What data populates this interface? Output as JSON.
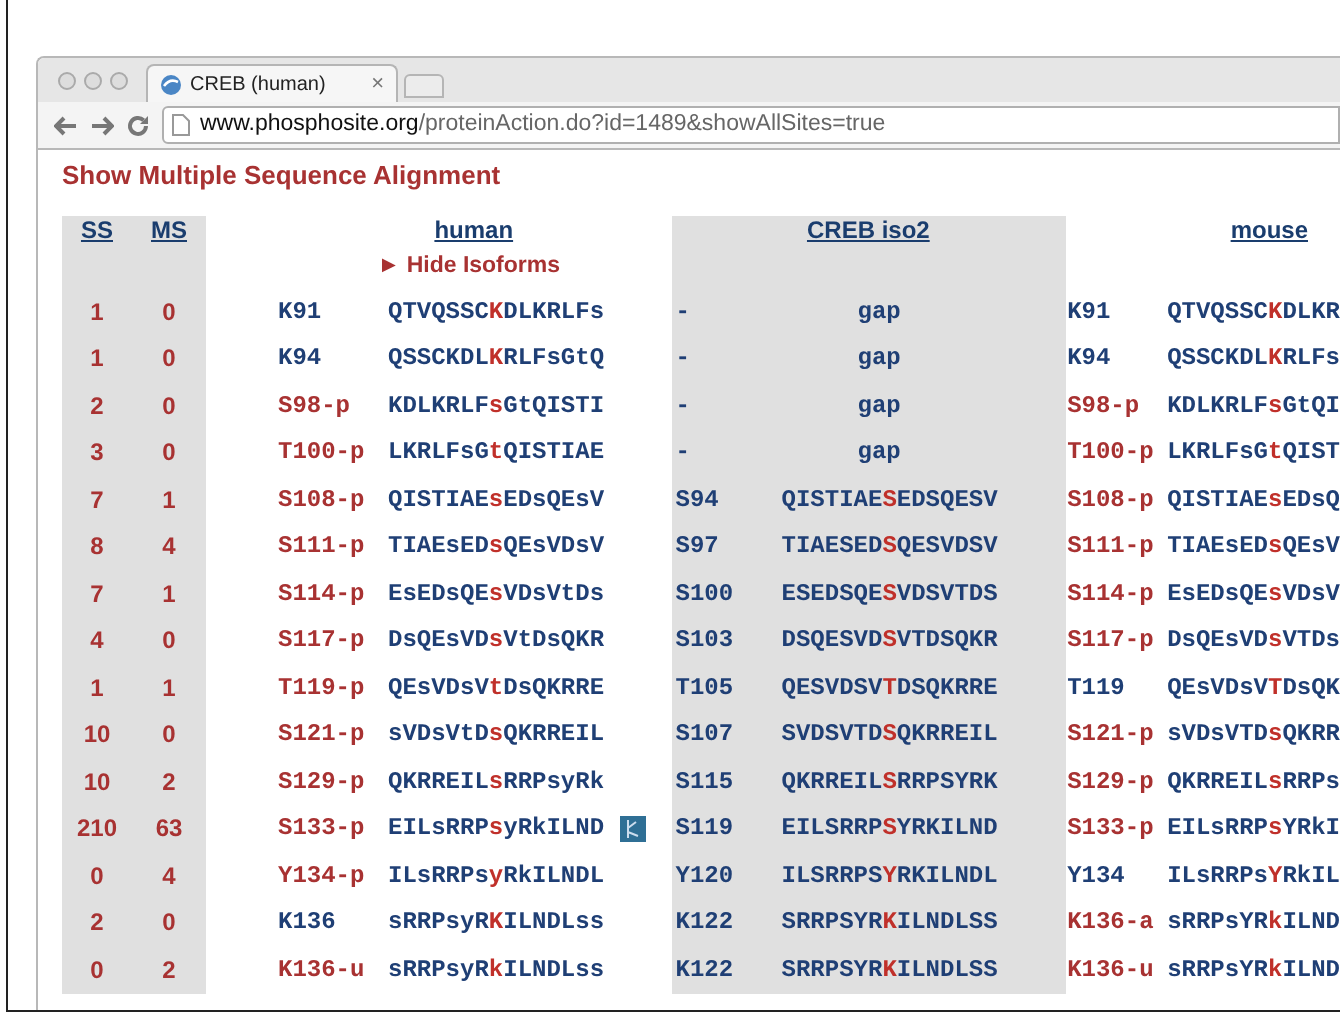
{
  "browser": {
    "tab_title": "CREB (human)",
    "tab_close": "×",
    "url_host": "www.phosphosite.org",
    "url_path": "/proteinAction.do?id=1489&showAllSites=true"
  },
  "page": {
    "title": "Show Multiple Sequence Alignment"
  },
  "table": {
    "columns": {
      "ss": "SS",
      "ms": "MS",
      "human": "human",
      "iso2": "CREB iso2",
      "mouse": "mouse"
    },
    "hide_isoforms": "► Hide Isoforms",
    "rows": [
      {
        "ss": "1",
        "ms": "0",
        "human": {
          "site": "K91",
          "color": "#1f3f75",
          "seq": [
            "QTVQSSC",
            "K",
            "DLKRLFs"
          ],
          "structure_icon": false
        },
        "iso2": {
          "kind": "gap",
          "site": "-",
          "text": "gap"
        },
        "mouse": {
          "site": "K91",
          "color": "#1f3f75",
          "seq": [
            "QTVQSSC",
            "K",
            "DLKR"
          ]
        }
      },
      {
        "ss": "1",
        "ms": "0",
        "human": {
          "site": "K94",
          "color": "#1f3f75",
          "seq": [
            "QSSCKDL",
            "K",
            "RLFsGtQ"
          ],
          "structure_icon": false
        },
        "iso2": {
          "kind": "gap",
          "site": "-",
          "text": "gap"
        },
        "mouse": {
          "site": "K94",
          "color": "#1f3f75",
          "seq": [
            "QSSCKDL",
            "K",
            "RLFs"
          ]
        }
      },
      {
        "ss": "2",
        "ms": "0",
        "human": {
          "site": "S98-p",
          "color": "#a83232",
          "seq": [
            "KDLKRLF",
            "s",
            "GtQISTI"
          ],
          "structure_icon": false
        },
        "iso2": {
          "kind": "gap",
          "site": "-",
          "text": "gap"
        },
        "mouse": {
          "site": "S98-p",
          "color": "#a83232",
          "seq": [
            "KDLKRLF",
            "s",
            "GtQI"
          ]
        }
      },
      {
        "ss": "3",
        "ms": "0",
        "human": {
          "site": "T100-p",
          "color": "#a83232",
          "seq": [
            "LKRLFsG",
            "t",
            "QISTIAE"
          ],
          "structure_icon": false
        },
        "iso2": {
          "kind": "gap",
          "site": "-",
          "text": "gap"
        },
        "mouse": {
          "site": "T100-p",
          "color": "#a83232",
          "seq": [
            "LKRLFsG",
            "t",
            "QIST"
          ]
        }
      },
      {
        "ss": "7",
        "ms": "1",
        "human": {
          "site": "S108-p",
          "color": "#a83232",
          "seq": [
            "QISTIAE",
            "s",
            "EDsQEsV"
          ],
          "structure_icon": false
        },
        "iso2": {
          "kind": "site",
          "site": "S94",
          "seq": [
            "QISTIAE",
            "S",
            "EDSQESV"
          ]
        },
        "mouse": {
          "site": "S108-p",
          "color": "#a83232",
          "seq": [
            "QISTIAE",
            "s",
            "EDsQ"
          ]
        }
      },
      {
        "ss": "8",
        "ms": "4",
        "human": {
          "site": "S111-p",
          "color": "#a83232",
          "seq": [
            "TIAEsED",
            "s",
            "QEsVDsV"
          ],
          "structure_icon": false
        },
        "iso2": {
          "kind": "site",
          "site": "S97",
          "seq": [
            "TIAESED",
            "S",
            "QESVDSV"
          ]
        },
        "mouse": {
          "site": "S111-p",
          "color": "#a83232",
          "seq": [
            "TIAEsED",
            "s",
            "QEsV"
          ]
        }
      },
      {
        "ss": "7",
        "ms": "1",
        "human": {
          "site": "S114-p",
          "color": "#a83232",
          "seq": [
            "EsEDsQE",
            "s",
            "VDsVtDs"
          ],
          "structure_icon": false
        },
        "iso2": {
          "kind": "site",
          "site": "S100",
          "seq": [
            "ESEDSQE",
            "S",
            "VDSVTDS"
          ]
        },
        "mouse": {
          "site": "S114-p",
          "color": "#a83232",
          "seq": [
            "EsEDsQE",
            "s",
            "VDsV"
          ]
        }
      },
      {
        "ss": "4",
        "ms": "0",
        "human": {
          "site": "S117-p",
          "color": "#a83232",
          "seq": [
            "DsQEsVD",
            "s",
            "VtDsQKR"
          ],
          "structure_icon": false
        },
        "iso2": {
          "kind": "site",
          "site": "S103",
          "seq": [
            "DSQESVD",
            "S",
            "VTDSQKR"
          ]
        },
        "mouse": {
          "site": "S117-p",
          "color": "#a83232",
          "seq": [
            "DsQEsVD",
            "s",
            "VTDs"
          ]
        }
      },
      {
        "ss": "1",
        "ms": "1",
        "human": {
          "site": "T119-p",
          "color": "#a83232",
          "seq": [
            "QEsVDsV",
            "t",
            "DsQKRRE"
          ],
          "structure_icon": false
        },
        "iso2": {
          "kind": "site",
          "site": "T105",
          "seq": [
            "QESVDSV",
            "T",
            "DSQKRRE"
          ]
        },
        "mouse": {
          "site": "T119",
          "color": "#1f3f75",
          "seq": [
            "QEsVDsV",
            "T",
            "DsQK"
          ]
        }
      },
      {
        "ss": "10",
        "ms": "0",
        "human": {
          "site": "S121-p",
          "color": "#a83232",
          "seq": [
            "sVDsVtD",
            "s",
            "QKRREIL"
          ],
          "structure_icon": false
        },
        "iso2": {
          "kind": "site",
          "site": "S107",
          "seq": [
            "SVDSVTD",
            "S",
            "QKRREIL"
          ]
        },
        "mouse": {
          "site": "S121-p",
          "color": "#a83232",
          "seq": [
            "sVDsVTD",
            "s",
            "QKRR"
          ]
        }
      },
      {
        "ss": "10",
        "ms": "2",
        "human": {
          "site": "S129-p",
          "color": "#a83232",
          "seq": [
            "QKRREIL",
            "s",
            "RRPsyRk"
          ],
          "structure_icon": false
        },
        "iso2": {
          "kind": "site",
          "site": "S115",
          "seq": [
            "QKRREIL",
            "S",
            "RRPSYRK"
          ]
        },
        "mouse": {
          "site": "S129-p",
          "color": "#a83232",
          "seq": [
            "QKRREIL",
            "s",
            "RRPs"
          ]
        }
      },
      {
        "ss": "210",
        "ms": "63",
        "human": {
          "site": "S133-p",
          "color": "#a83232",
          "seq": [
            "EILsRRP",
            "s",
            "yRkILND"
          ],
          "structure_icon": true
        },
        "iso2": {
          "kind": "site",
          "site": "S119",
          "seq": [
            "EILSRRP",
            "S",
            "YRKILND"
          ]
        },
        "mouse": {
          "site": "S133-p",
          "color": "#a83232",
          "seq": [
            "EILsRRP",
            "s",
            "YRkI"
          ]
        }
      },
      {
        "ss": "0",
        "ms": "4",
        "human": {
          "site": "Y134-p",
          "color": "#a83232",
          "seq": [
            "ILsRRPs",
            "y",
            "RkILNDL"
          ],
          "structure_icon": false
        },
        "iso2": {
          "kind": "site",
          "site": "Y120",
          "seq": [
            "ILSRRPS",
            "Y",
            "RKILNDL"
          ]
        },
        "mouse": {
          "site": "Y134",
          "color": "#1f3f75",
          "seq": [
            "ILsRRPs",
            "Y",
            "RkIL"
          ]
        }
      },
      {
        "ss": "2",
        "ms": "0",
        "human": {
          "site": "K136",
          "color": "#1f3f75",
          "seq": [
            "sRRPsyR",
            "K",
            "ILNDLss"
          ],
          "structure_icon": false
        },
        "iso2": {
          "kind": "site",
          "site": "K122",
          "seq": [
            "SRRPSYR",
            "K",
            "ILNDLSS"
          ]
        },
        "mouse": {
          "site": "K136-a",
          "color": "#a83232",
          "seq": [
            "sRRPsYR",
            "k",
            "ILND"
          ]
        }
      },
      {
        "ss": "0",
        "ms": "2",
        "human": {
          "site": "K136-u",
          "color": "#a83232",
          "seq": [
            "sRRPsyR",
            "k",
            "ILNDLss"
          ],
          "structure_icon": false
        },
        "iso2": {
          "kind": "site",
          "site": "K122",
          "seq": [
            "SRRPSYR",
            "K",
            "ILNDLSS"
          ]
        },
        "mouse": {
          "site": "K136-u",
          "color": "#a83232",
          "seq": [
            "sRRPsYR",
            "k",
            "ILND"
          ]
        }
      }
    ]
  }
}
